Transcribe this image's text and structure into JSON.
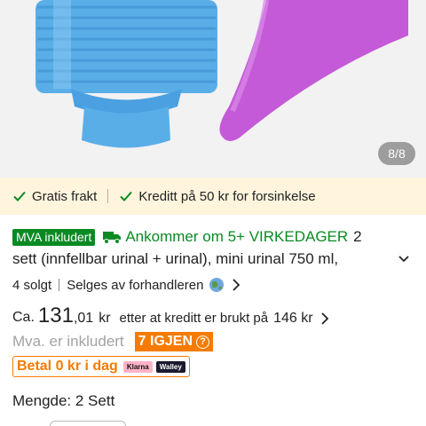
{
  "gallery": {
    "counter": "8/8"
  },
  "benefits": {
    "free_shipping": "Gratis frakt",
    "credit": "Kreditt på 50 kr for forsinkelse"
  },
  "product": {
    "vat_badge": "MVA inkludert",
    "arrival": "Ankommer om 5+ VIRKEDAGER",
    "title_line1": "2",
    "title_line2": "sett (innfellbar urinal + urinal), mini urinal 750 ml,",
    "sold": "4 solgt",
    "seller": "Selges av forhandleren",
    "price_prefix": "Ca.",
    "price_int": "131",
    "price_dec": ",01",
    "price_currency": "kr",
    "credit_note": "etter at kreditt er brukt på",
    "credit_amount": "146 kr",
    "vat_text": "Mva. er inkludert",
    "stock": "7 IGJEN",
    "bnpl": "Betal 0 kr i dag",
    "klarna": "Klarna",
    "walley": "Walley",
    "quantity": "Mengde: 2 Sett"
  },
  "colors": {
    "green": "#0a8a23",
    "orange": "#f67b00",
    "benefit_bg": "#fff5dd"
  }
}
